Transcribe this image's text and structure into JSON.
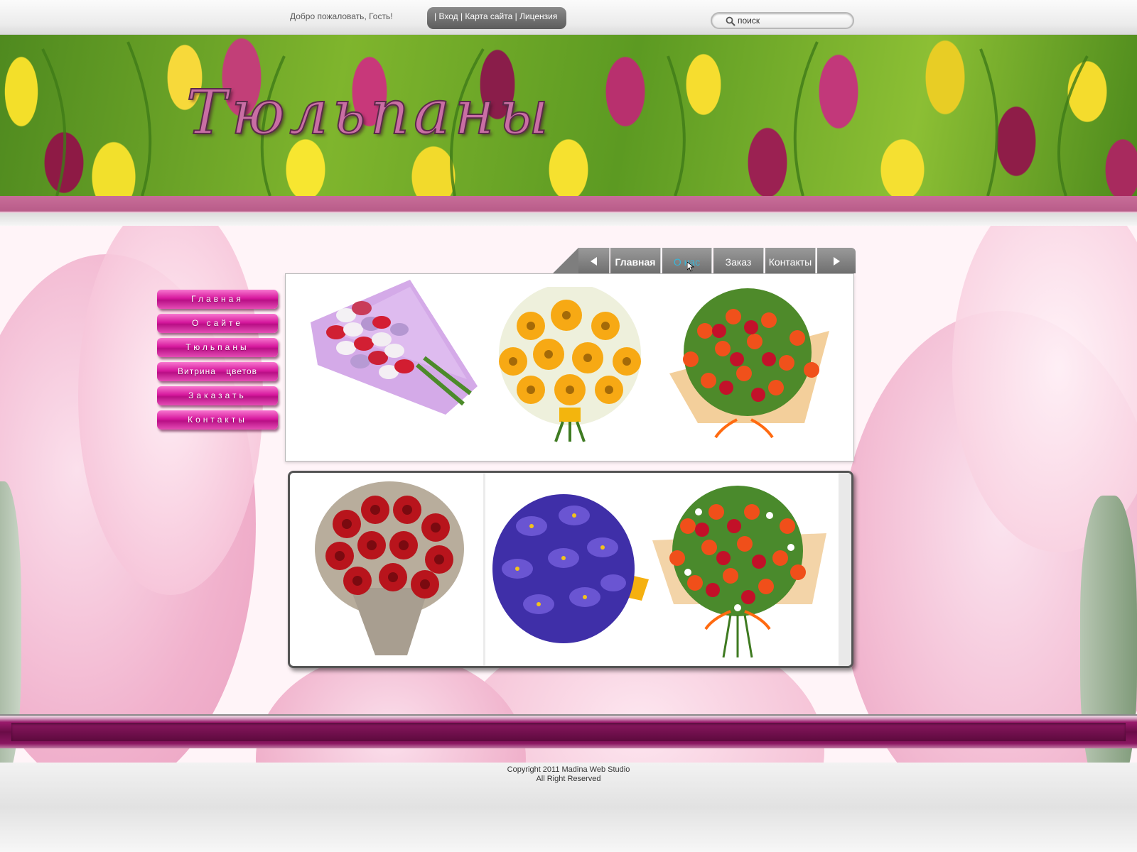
{
  "header": {
    "welcome": "Добро пожаловать, Гость!",
    "links": [
      "Вход",
      "Карта сайта",
      "Лицензия"
    ],
    "search_placeholder": "поиск"
  },
  "banner": {
    "title": "Тюльпаны"
  },
  "tabs": {
    "items": [
      "Главная",
      "О нас",
      "Заказ",
      "Контакты"
    ],
    "active": "Главная",
    "hovered": "О нас"
  },
  "side_menu": [
    "Главная",
    "О сайте",
    "Тюльпаны",
    "Витрина цветов",
    "Заказать",
    "Контакты"
  ],
  "gallery": {
    "row1": [
      "tulip-bouquet-image",
      "gerbera-chamomile-bouquet-image",
      "tulip-orange-bouquet-image"
    ],
    "row2": [
      "red-roses-bouquet-image",
      "iris-bouquet-image",
      "mixed-tulip-chamomile-bouquet-image"
    ]
  },
  "footer": {
    "copyright": "Copyright 2011 Madina Web Studio",
    "rights": "All Right Reserved"
  },
  "colors": {
    "accent_pink": "#d6189d",
    "band_pink": "#c86d98",
    "footer_purple": "#6a0c47",
    "tab_grey": "#7e7e7e",
    "hover_blue": "#39b6d8"
  }
}
